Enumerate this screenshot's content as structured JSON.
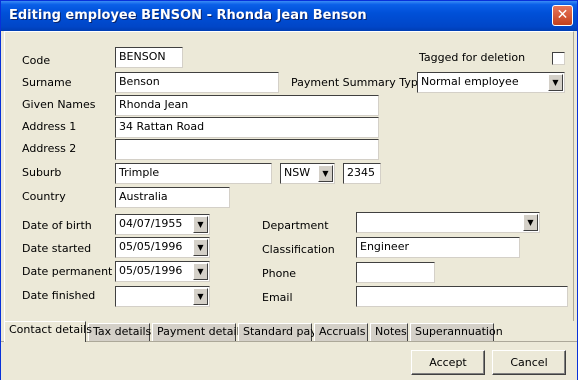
{
  "window": {
    "title": "Editing employee BENSON - Rhonda Jean Benson",
    "close_glyph": "✕"
  },
  "labels": {
    "code": "Code",
    "surname": "Surname",
    "given_names": "Given Names",
    "address1": "Address 1",
    "address2": "Address 2",
    "suburb": "Suburb",
    "country": "Country",
    "tagged": "Tagged for deletion",
    "payment_summary_type": "Payment Summary Type",
    "date_of_birth": "Date of birth",
    "date_started": "Date started",
    "date_permanent": "Date permanent",
    "date_finished": "Date finished",
    "department": "Department",
    "classification": "Classification",
    "phone": "Phone",
    "email": "Email"
  },
  "fields": {
    "code": "BENSON",
    "surname": "Benson",
    "given_names": "Rhonda Jean",
    "address1": "34 Rattan Road",
    "address2": "",
    "suburb": "Trimple",
    "state": "NSW",
    "postcode": "2345",
    "country": "Australia",
    "payment_summary_type": "Normal employee",
    "date_of_birth": "04/07/1955",
    "date_started": "05/05/1996",
    "date_permanent": "05/05/1996",
    "date_finished": "",
    "department": "",
    "classification": "Engineer",
    "phone": "",
    "email": ""
  },
  "tabs": [
    "Contact details",
    "Tax details",
    "Payment details",
    "Standard pay",
    "Accruals",
    "Notes",
    "Superannuation"
  ],
  "buttons": {
    "accept": "Accept",
    "cancel": "Cancel"
  },
  "icons": {
    "dropdown": "▼"
  }
}
